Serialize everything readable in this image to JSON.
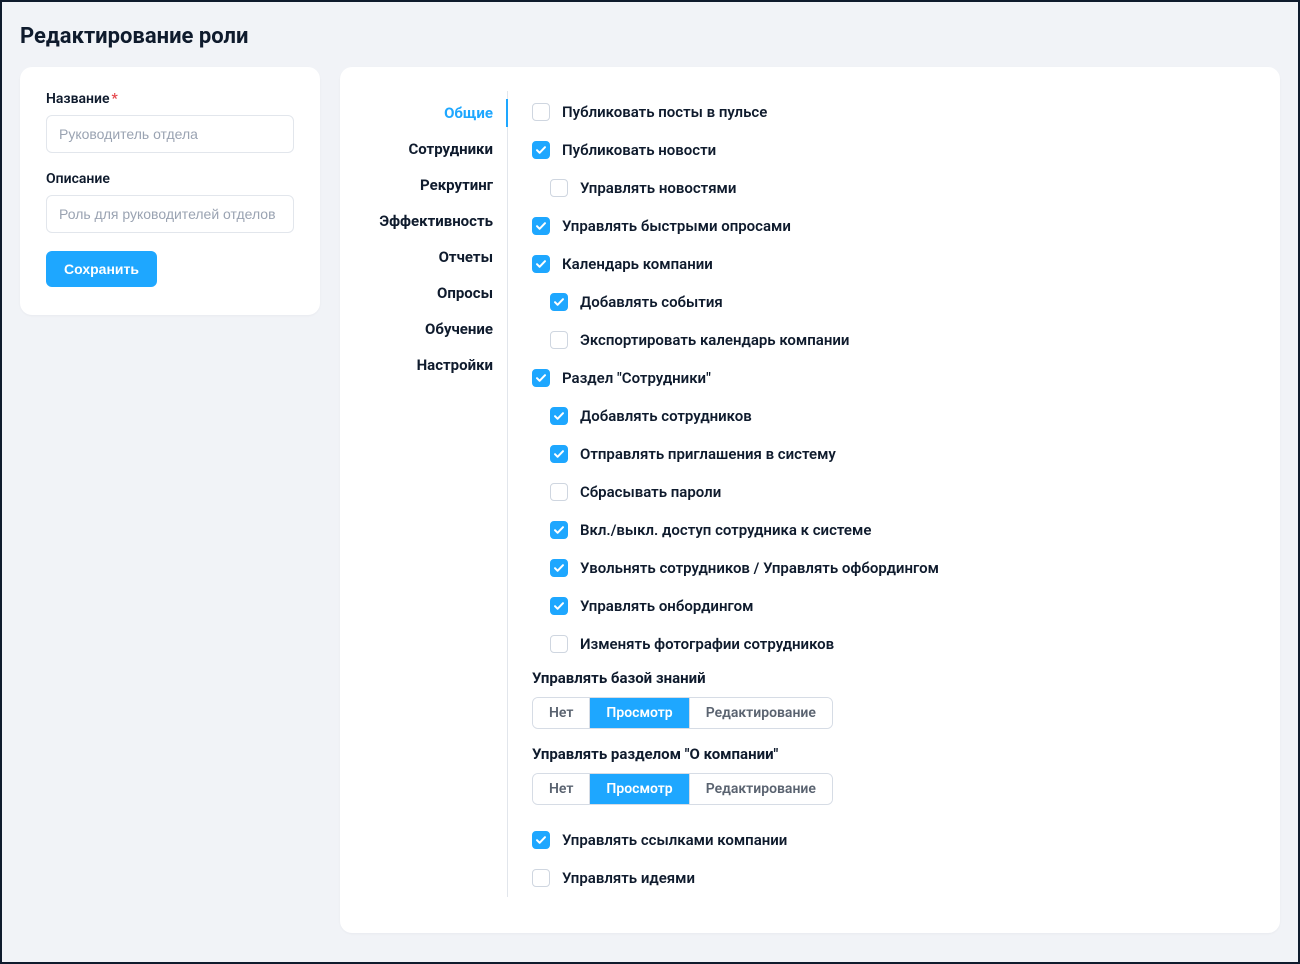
{
  "page": {
    "title": "Редактирование роли"
  },
  "form": {
    "name_label": "Название",
    "name_placeholder": "Руководитель отдела",
    "desc_label": "Описание",
    "desc_placeholder": "Роль для руководителей отделов",
    "save_label": "Сохранить"
  },
  "tabs": [
    {
      "label": "Общие",
      "active": true
    },
    {
      "label": "Сотрудники",
      "active": false
    },
    {
      "label": "Рекрутинг",
      "active": false
    },
    {
      "label": "Эффективность",
      "active": false
    },
    {
      "label": "Отчеты",
      "active": false
    },
    {
      "label": "Опросы",
      "active": false
    },
    {
      "label": "Обучение",
      "active": false
    },
    {
      "label": "Настройки",
      "active": false
    }
  ],
  "permissions": [
    {
      "type": "check",
      "label": "Публиковать посты в пульсе",
      "checked": false,
      "indent": false
    },
    {
      "type": "check",
      "label": "Публиковать новости",
      "checked": true,
      "indent": false
    },
    {
      "type": "check",
      "label": "Управлять новостями",
      "checked": false,
      "indent": true
    },
    {
      "type": "check",
      "label": "Управлять быстрыми опросами",
      "checked": true,
      "indent": false
    },
    {
      "type": "check",
      "label": "Календарь компании",
      "checked": true,
      "indent": false
    },
    {
      "type": "check",
      "label": "Добавлять события",
      "checked": true,
      "indent": true
    },
    {
      "type": "check",
      "label": "Экспортировать календарь компании",
      "checked": false,
      "indent": true
    },
    {
      "type": "check",
      "label": "Раздел \"Сотрудники\"",
      "checked": true,
      "indent": false
    },
    {
      "type": "check",
      "label": "Добавлять сотрудников",
      "checked": true,
      "indent": true
    },
    {
      "type": "check",
      "label": "Отправлять приглашения в систему",
      "checked": true,
      "indent": true
    },
    {
      "type": "check",
      "label": "Сбрасывать пароли",
      "checked": false,
      "indent": true
    },
    {
      "type": "check",
      "label": "Вкл./выкл. доступ сотрудника к системе",
      "checked": true,
      "indent": true
    },
    {
      "type": "check",
      "label": "Увольнять сотрудников / Управлять офбордингом",
      "checked": true,
      "indent": true
    },
    {
      "type": "check",
      "label": "Управлять онбордингом",
      "checked": true,
      "indent": true
    },
    {
      "type": "check",
      "label": "Изменять фотографии сотрудников",
      "checked": false,
      "indent": true
    },
    {
      "type": "segment",
      "label": "Управлять базой знаний",
      "options": [
        {
          "label": "Нет",
          "active": false
        },
        {
          "label": "Просмотр",
          "active": true
        },
        {
          "label": "Редактирование",
          "active": false
        }
      ]
    },
    {
      "type": "segment",
      "label": "Управлять разделом \"О компании\"",
      "options": [
        {
          "label": "Нет",
          "active": false
        },
        {
          "label": "Просмотр",
          "active": true
        },
        {
          "label": "Редактирование",
          "active": false
        }
      ]
    },
    {
      "type": "check",
      "label": "Управлять ссылками компании",
      "checked": true,
      "indent": false
    },
    {
      "type": "check",
      "label": "Управлять идеями",
      "checked": false,
      "indent": false
    }
  ]
}
